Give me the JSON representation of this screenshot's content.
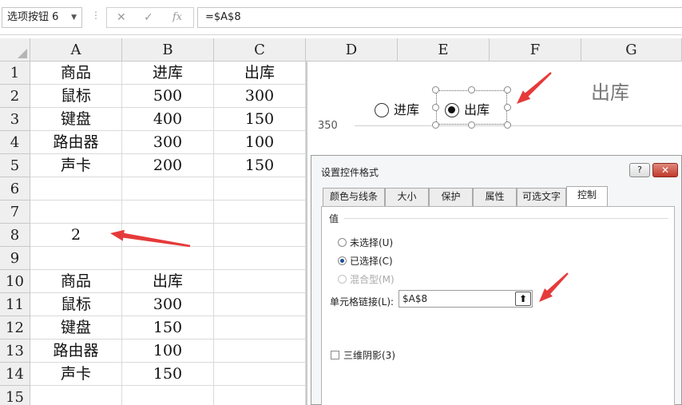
{
  "formula_bar": {
    "name_box": "选项按钮 6",
    "cancel_glyph": "✕",
    "enter_glyph": "✓",
    "fx_glyph": "fx",
    "formula": "=$A$8"
  },
  "columns": [
    "A",
    "B",
    "C",
    "D",
    "E",
    "F",
    "G"
  ],
  "rows": [
    "1",
    "2",
    "3",
    "4",
    "5",
    "6",
    "7",
    "8",
    "9",
    "10",
    "11",
    "12",
    "13",
    "14",
    "15"
  ],
  "table1": {
    "headers": [
      "商品",
      "进库",
      "出库"
    ],
    "rows": [
      [
        "鼠标",
        "500",
        "300"
      ],
      [
        "键盘",
        "400",
        "150"
      ],
      [
        "路由器",
        "300",
        "100"
      ],
      [
        "声卡",
        "200",
        "150"
      ]
    ]
  },
  "link_value": "2",
  "table2": {
    "headers": [
      "商品",
      "出库"
    ],
    "rows": [
      [
        "鼠标",
        "300"
      ],
      [
        "键盘",
        "150"
      ],
      [
        "路由器",
        "100"
      ],
      [
        "声卡",
        "150"
      ]
    ]
  },
  "chart": {
    "title": "出库",
    "axis_value": "350",
    "option_in": "进库",
    "option_out": "出库",
    "selected": "出库"
  },
  "dialog": {
    "title": "设置控件格式",
    "help": "?",
    "close": "✕",
    "tabs": [
      "颜色与线条",
      "大小",
      "保护",
      "属性",
      "可选文字",
      "控制"
    ],
    "active_tab": "控制",
    "group_label": "值",
    "options": [
      {
        "label": "未选择(U)",
        "state": "off"
      },
      {
        "label": "已选择(C)",
        "state": "on"
      },
      {
        "label": "混合型(M)",
        "state": "disabled"
      }
    ],
    "cell_link_label": "单元格链接(L):",
    "cell_link_value": "$A$8",
    "cell_link_button": "⬆",
    "shadow_label": "三维阴影(3)",
    "shadow_checked": false
  },
  "colors": {
    "annotation_arrow": "#e63a3a",
    "header_bg": "#efefef",
    "gridline": "#dadada"
  }
}
